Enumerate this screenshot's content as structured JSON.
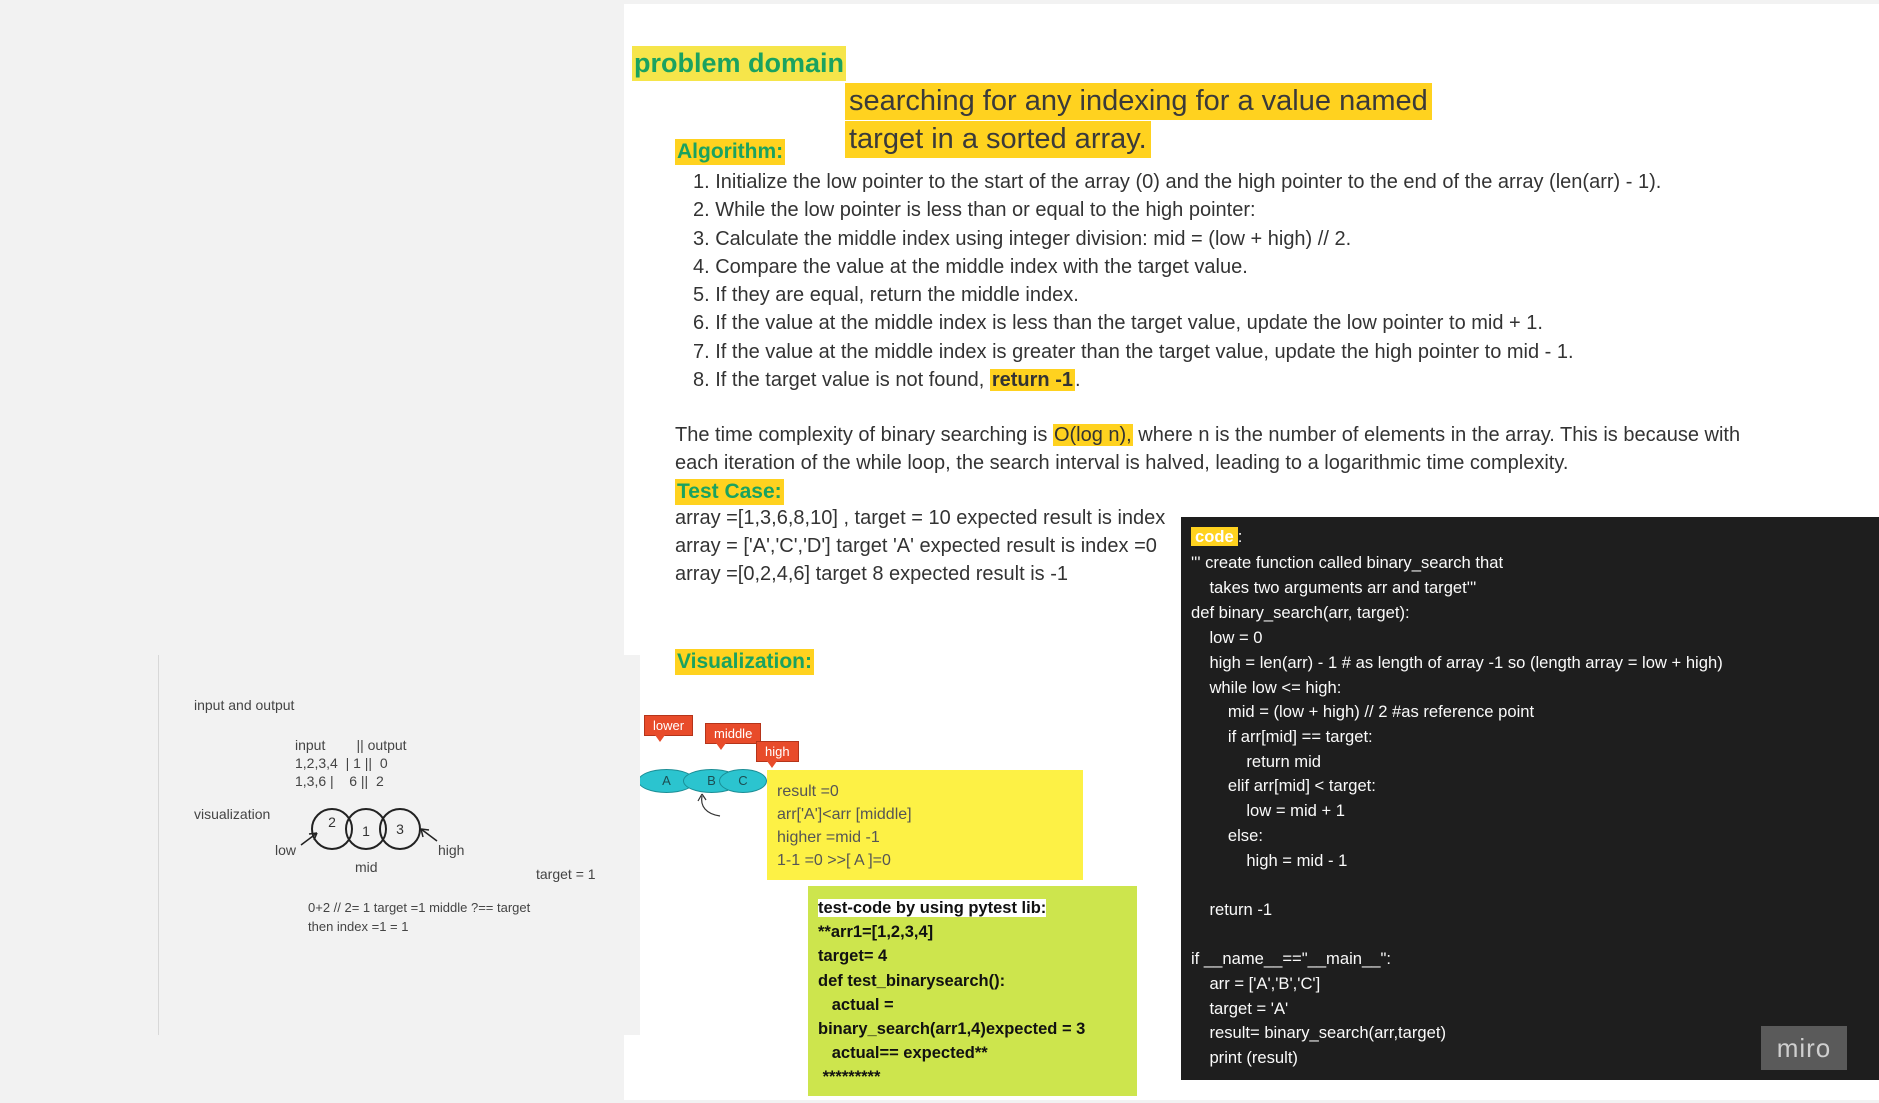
{
  "problem_domain": {
    "title": "problem domain",
    "line1": "searching for any indexing for a value named",
    "line2": "target in a sorted array."
  },
  "algorithm": {
    "title": "Algorithm:",
    "steps": [
      "1. Initialize the low pointer to the start of the array (0) and the high pointer to the end of the array (len(arr) - 1).",
      "2. While the low pointer is less than or equal to the high pointer:",
      "3. Calculate the middle index using integer division: mid = (low + high) // 2.",
      "4. Compare the value at the middle index with the target value.",
      "5. If they are equal, return the middle index.",
      "6. If the value at the middle index is less than the target value, update the low pointer to mid + 1.",
      "7. If the value at the middle index is greater than the target value, update the high pointer to mid - 1.",
      "8. If the target value is not found, "
    ],
    "step8_bold": "return -1",
    "step8_end": "."
  },
  "complexity": {
    "before": "The time complexity of binary searching is ",
    "highlight": "O(log n),",
    "after": " where n is the number of elements in the array. This is because with each iteration of the while loop, the search interval is halved, leading to a logarithmic time complexity."
  },
  "test_case": {
    "title": "Test Case:",
    "lines": [
      "array =[1,3,6,8,10] , target = 10 expected result is index",
      "array = ['A','C','D'] target 'A' expected result is index =0",
      "array =[0,2,4,6] target 8 expected result is -1"
    ]
  },
  "visualization": {
    "title": "Visualization:",
    "tags": [
      "lower",
      "middle",
      "high"
    ],
    "nodes": [
      "A",
      "B",
      "C"
    ],
    "sticky_lines": [
      "result =0",
      "arr['A']<arr [middle]",
      "higher =mid -1",
      "1-1 =0 >>[ A ]=0"
    ]
  },
  "left_panel": {
    "heading": "input and output",
    "table_header": "input        || output",
    "table_rows": [
      "1,2,3,4  | 1 ||  0",
      "1,3,6 |    6 ||  2"
    ],
    "viz_label": "visualization",
    "circles": [
      "2",
      "1",
      "3"
    ],
    "low_label": "low",
    "mid_label": "mid",
    "high_label": "high",
    "target_label": "target = 1",
    "note1": "0+2 // 2= 1 target =1 middle ?== target",
    "note2": "then index =1 = 1"
  },
  "test_code": {
    "lines": [
      "test-code by using pytest lib:",
      "**arr1=[1,2,3,4]",
      "target= 4",
      "def test_binarysearch():",
      "   actual =",
      "binary_search(arr1,4)expected = 3",
      "   actual== expected**",
      " *********"
    ]
  },
  "code": {
    "title": "code",
    "colon": ":",
    "lines": [
      "''' create function called binary_search that",
      "    takes two arguments arr and target'''",
      "def binary_search(arr, target):",
      "    low = 0",
      "    high = len(arr) - 1 # as length of array -1 so (length array = low + high)",
      "    while low <= high:",
      "        mid = (low + high) // 2 #as reference point",
      "        if arr[mid] == target:",
      "            return mid",
      "        elif arr[mid] < target:",
      "            low = mid + 1",
      "        else:",
      "            high = mid - 1",
      "",
      "    return -1",
      "",
      "if __name__==\"__main__\":",
      "    arr = ['A','B','C']",
      "    target = 'A'",
      "    result= binary_search(arr,target)",
      "    print (result)"
    ]
  },
  "brand": "miro"
}
